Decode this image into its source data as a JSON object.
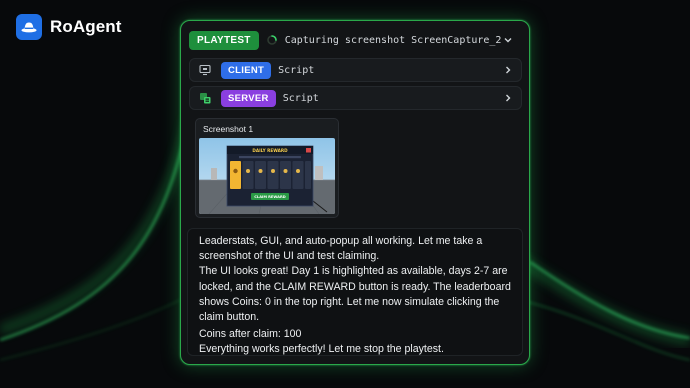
{
  "brand": {
    "name": "RoAgent",
    "logo_icon": "hat-icon",
    "accent": "#1f6fe5"
  },
  "playtest": {
    "badge": "PLAYTEST",
    "status": "Capturing screenshot ScreenCapture_2",
    "badge_color": "#1e8f3c"
  },
  "scripts": [
    {
      "icon": "monitor-icon",
      "badge": "CLIENT",
      "label": "Script",
      "color": "#2f6ee8"
    },
    {
      "icon": "server-icon",
      "badge": "SERVER",
      "label": "Script",
      "color": "#8a3fe0"
    }
  ],
  "screenshot": {
    "title": "Screenshot 1",
    "popup_title": "DAILY REWARD",
    "popup_button": "CLAIM REWARD",
    "days_count": 7
  },
  "message": {
    "para1": "Leaderstats, GUI, and auto-popup all working. Let me take a screenshot of the UI and test claiming.",
    "para2": "The UI looks great!  Day 1 is highlighted as available, days 2-7 are locked, and the CLAIM REWARD button is ready. The leaderboard shows Coins: 0 in the top right. Let me now simulate clicking the claim button.",
    "para3": "Coins after claim: 100",
    "para4": "Everything works perfectly! Let me stop the playtest."
  }
}
